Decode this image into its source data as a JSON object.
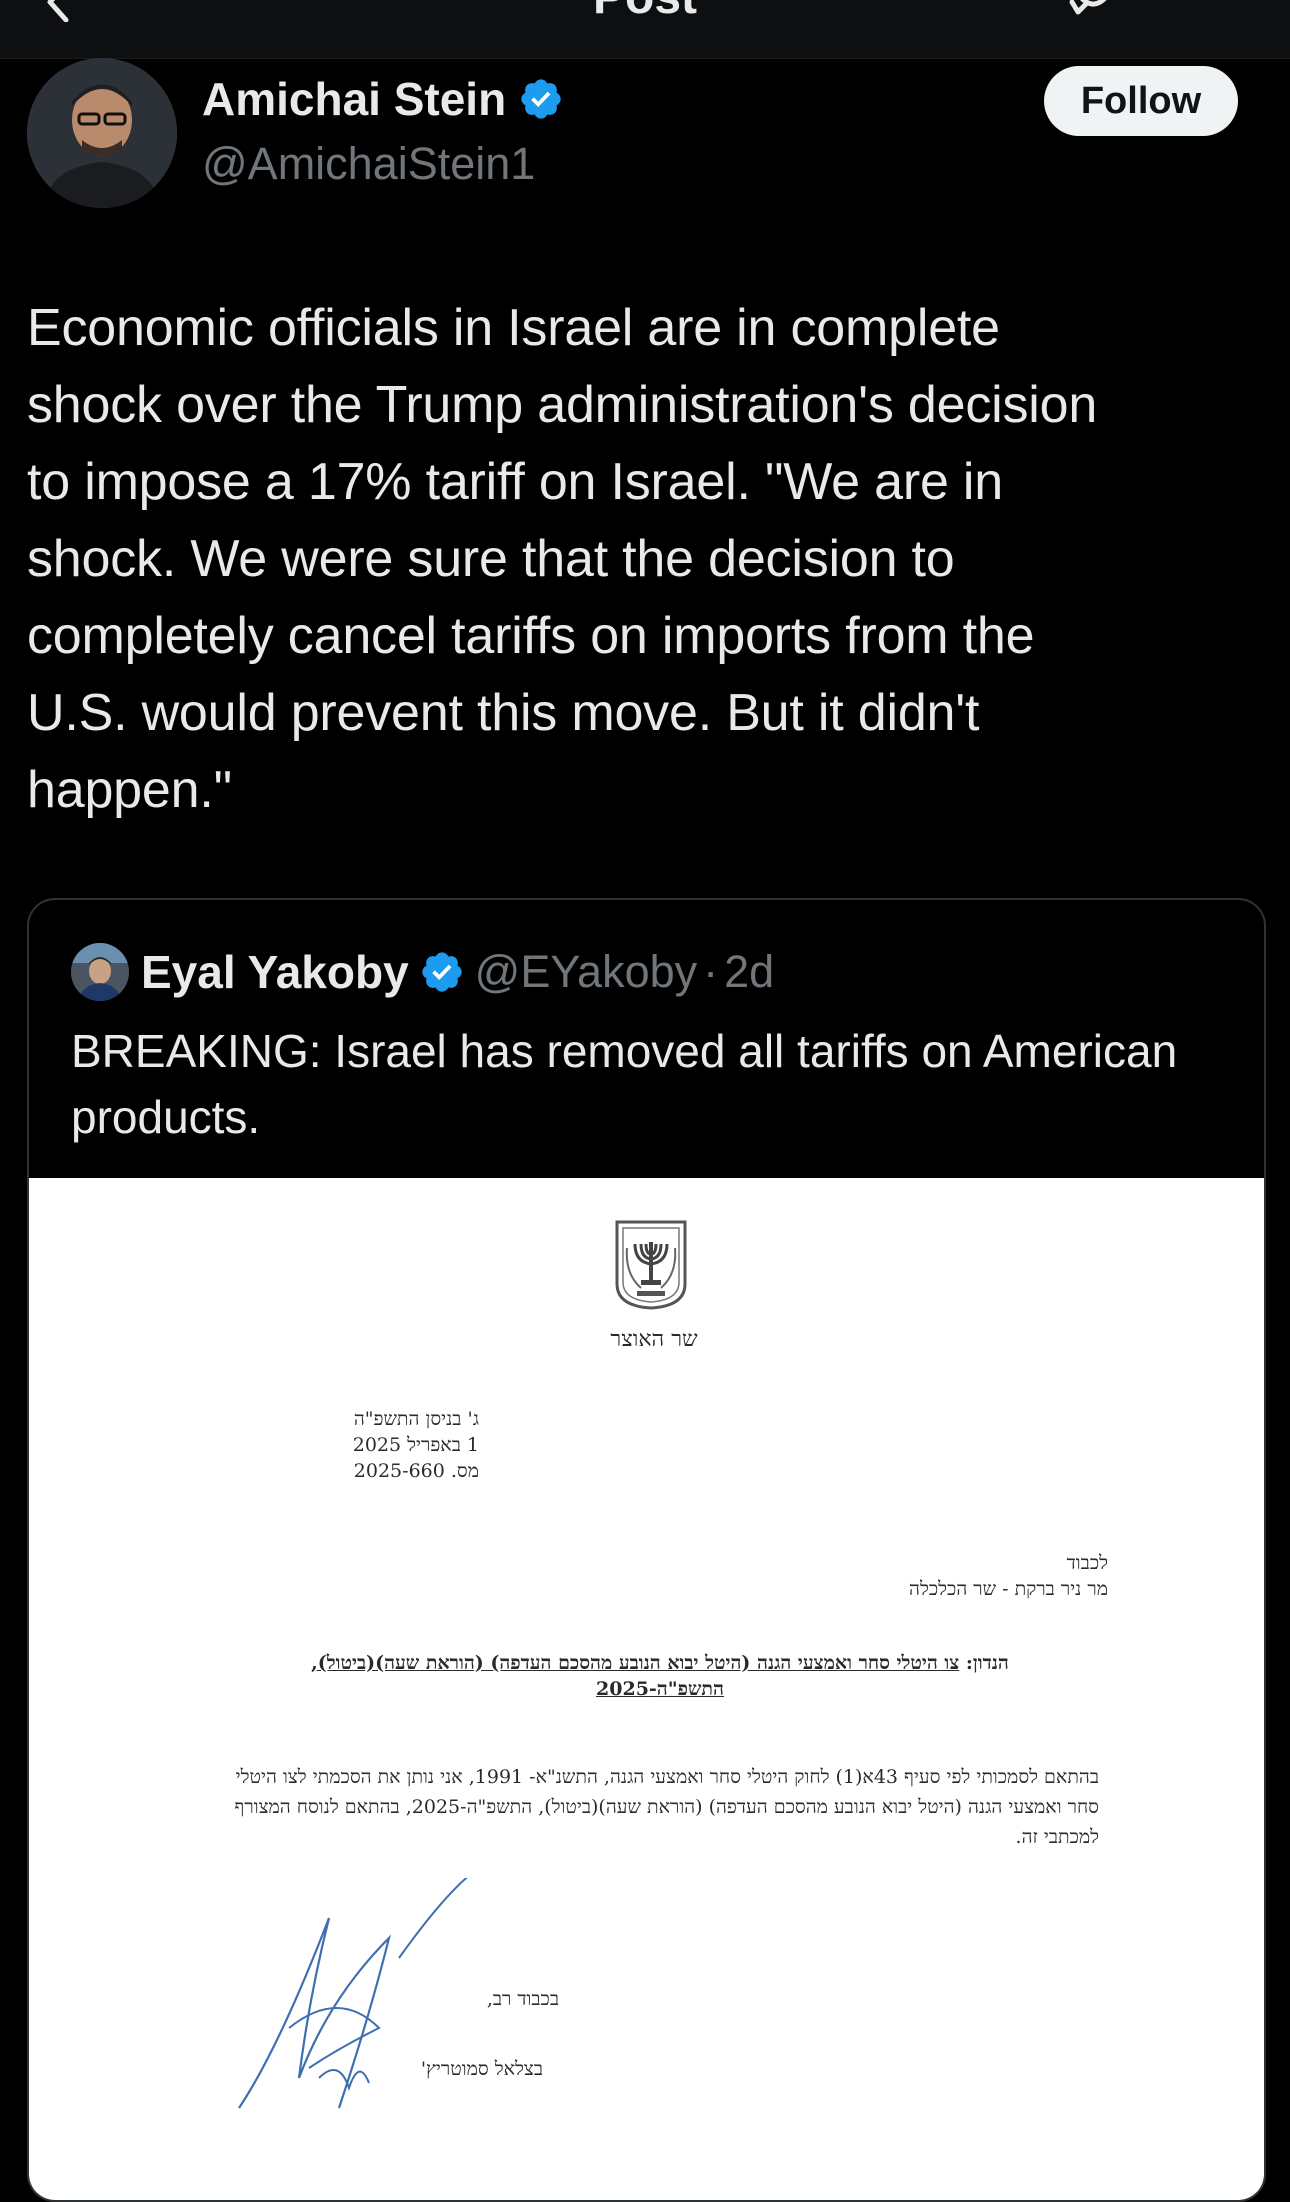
{
  "header": {
    "title": "Post"
  },
  "author": {
    "name": "Amichai Stein",
    "handle": "@AmichaiStein1",
    "verified": true,
    "follow_label": "Follow"
  },
  "tweet": {
    "text": "Economic officials in Israel are in complete\nshock over the Trump administration's decision\nto impose a 17% tariff on Israel. \"We are in\nshock. We were sure that the decision to\ncompletely cancel tariffs on imports from the\nU.S. would prevent this move. But it didn't\nhappen.\""
  },
  "quote": {
    "name": "Eyal Yakoby",
    "handle": "@EYakoby",
    "dot": "·",
    "time": "2d",
    "verified": true,
    "text": "BREAKING: Israel has removed all tariffs on American products."
  },
  "document": {
    "ministry": "שר האוצר",
    "date_lines": [
      "ג' בניסן התשפ\"ה",
      "1 באפריל 2025",
      "מס. 2025-660"
    ],
    "to_lines": [
      "לכבוד",
      "מר ניר ברקת - שר הכלכלה"
    ],
    "subject_prefix": "הנדון: ",
    "subject_text": "צו היטלי סחר ואמצעי הגנה (היטל יבוא הנובע מהסכם העדפה) (הוראת שעה)(ביטול), התשפ\"ה-2025",
    "body": "בהתאם לסמכותי לפי סעיף 43א(1) לחוק היטלי סחר ואמצעי הגנה, התשנ\"א- 1991, אני נותן את הסכמתי לצו היטלי סחר ואמצעי הגנה (היטל יבוא הנובע מהסכם העדפה) (הוראת שעה)(ביטול), התשפ\"ה-2025, בהתאם לנוסח המצורף למכתבי זה.",
    "closing": "בכבוד רב,",
    "signer": "בצלאל סמוטריץ'"
  },
  "colors": {
    "background": "#000000",
    "text": "#e7e9ea",
    "secondary": "#71767b",
    "verified": "#1d9bf0",
    "border": "#2f3336"
  },
  "icons": {
    "back": "back-arrow-icon",
    "refresh": "refresh-icon",
    "verified": "verified-badge-icon"
  }
}
